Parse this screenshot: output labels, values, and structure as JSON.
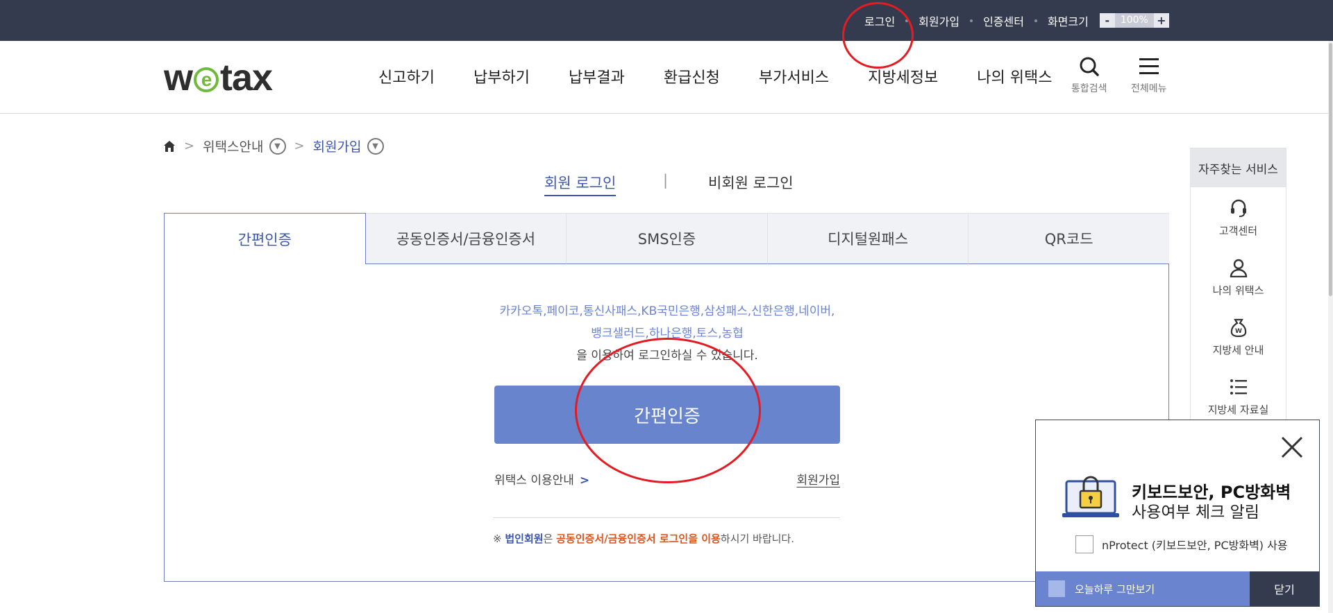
{
  "utility": {
    "login": "로그인",
    "signup": "회원가입",
    "cert_center": "인증센터",
    "screen_size": "화면크기",
    "zoom_minus": "-",
    "zoom_value": "100%",
    "zoom_plus": "+"
  },
  "header": {
    "logo_w": "w",
    "logo_e": "e",
    "logo_tax": "tax",
    "nav": [
      "신고하기",
      "납부하기",
      "납부결과",
      "환급신청",
      "부가서비스",
      "지방세정보",
      "나의 위택스"
    ],
    "search_label": "통합검색",
    "menu_label": "전체메뉴"
  },
  "breadcrumb": {
    "level1": "위택스안내",
    "level2": "회원가입"
  },
  "member_tabs": {
    "member": "회원 로그인",
    "separator": "|",
    "nonmember": "비회원 로그인"
  },
  "auth_tabs": [
    "간편인증",
    "공동인증서/금융인증서",
    "SMS인증",
    "디지털원패스",
    "QR코드"
  ],
  "easy_auth": {
    "providers_line1": "카카오톡,페이코,통신사패스,KB국민은행,삼성패스,신한은행,네이버,",
    "providers_line2": "뱅크샐러드,하나은행,토스,농협",
    "desc_line3": "을 이용하여 로그인하실 수 있습니다.",
    "button": "간편인증",
    "guide_link": "위택스 이용안내",
    "guide_chevron": ">",
    "join_link": "회원가입",
    "note_prefix": "※ ",
    "note_corp": "법인회원",
    "note_mid": "은 ",
    "note_cert": "공동인증서/금융인증서 로그인을 이용",
    "note_suffix": "하시기 바랍니다."
  },
  "quick_service": {
    "title": "자주찾는 서비스",
    "items": [
      "고객센터",
      "나의 위택스",
      "지방세 안내",
      "지방세 자료실"
    ]
  },
  "popup": {
    "title_line1": "키보드보안, PC방화벽",
    "title_line2": "사용여부 체크 알림",
    "checkbox_label": "nProtect (키보드보안, PC방화벽) 사용",
    "today_hide": "오늘하루 그만보기",
    "close": "닫기"
  },
  "colors": {
    "topbar": "#343b4f",
    "accent_blue": "#3b56b2",
    "button_blue": "#6884cd",
    "annotation_red": "#e31b23",
    "logo_green": "#6fba3a"
  }
}
